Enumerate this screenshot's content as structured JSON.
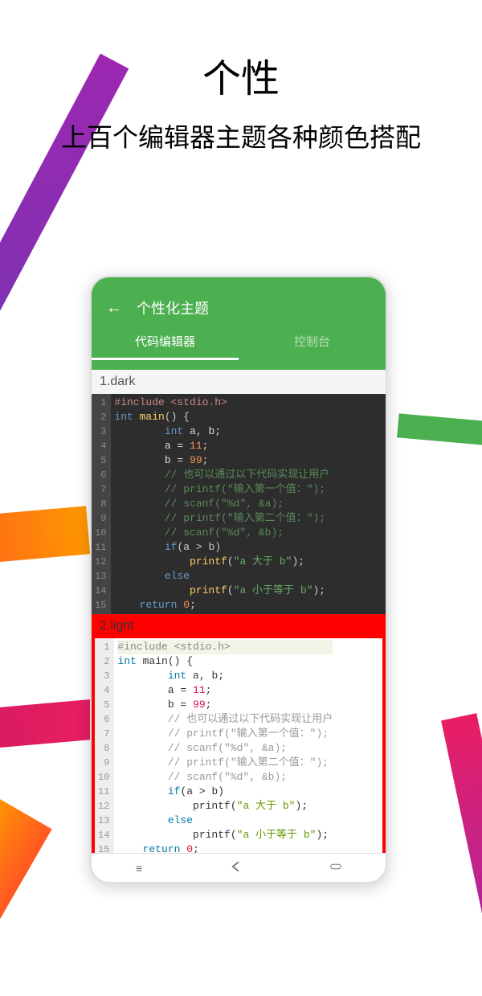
{
  "title": "个性",
  "subtitle": "上百个编辑器主题各种颜色搭配",
  "device": {
    "toolbar_title": "个性化主题",
    "tabs": {
      "editor": "代码编辑器",
      "console": "控制台"
    }
  },
  "themes": {
    "dark_label": "1.dark",
    "light_label": "2.light"
  },
  "code": {
    "line_numbers": [
      "1",
      "2",
      "3",
      "4",
      "5",
      "6",
      "7",
      "8",
      "9",
      "10",
      "11",
      "12",
      "13",
      "14",
      "15"
    ],
    "lines": [
      {
        "tokens": [
          {
            "t": "#include <stdio.h>",
            "c": "pp"
          }
        ]
      },
      {
        "tokens": [
          {
            "t": "int",
            "c": "kw"
          },
          {
            "t": " ",
            "c": "id"
          },
          {
            "t": "main",
            "c": "fn"
          },
          {
            "t": "() {",
            "c": "pn"
          }
        ]
      },
      {
        "tokens": [
          {
            "t": "        ",
            "c": "id"
          },
          {
            "t": "int",
            "c": "kw"
          },
          {
            "t": " a, b;",
            "c": "id"
          }
        ]
      },
      {
        "tokens": [
          {
            "t": "        a = ",
            "c": "id"
          },
          {
            "t": "11",
            "c": "num"
          },
          {
            "t": ";",
            "c": "pn"
          }
        ]
      },
      {
        "tokens": [
          {
            "t": "        b = ",
            "c": "id"
          },
          {
            "t": "99",
            "c": "num"
          },
          {
            "t": ";",
            "c": "pn"
          }
        ]
      },
      {
        "tokens": [
          {
            "t": "        ",
            "c": "id"
          },
          {
            "t": "// 也可以通过以下代码实现让用户",
            "c": "cm"
          }
        ]
      },
      {
        "tokens": [
          {
            "t": "        ",
            "c": "id"
          },
          {
            "t": "// printf(\"输入第一个值：\");",
            "c": "cm"
          }
        ]
      },
      {
        "tokens": [
          {
            "t": "        ",
            "c": "id"
          },
          {
            "t": "// scanf(\"%d\", &a);",
            "c": "cm"
          }
        ]
      },
      {
        "tokens": [
          {
            "t": "        ",
            "c": "id"
          },
          {
            "t": "// printf(\"输入第二个值：\");",
            "c": "cm"
          }
        ]
      },
      {
        "tokens": [
          {
            "t": "        ",
            "c": "id"
          },
          {
            "t": "// scanf(\"%d\", &b);",
            "c": "cm"
          }
        ]
      },
      {
        "tokens": [
          {
            "t": "        ",
            "c": "id"
          },
          {
            "t": "if",
            "c": "kw"
          },
          {
            "t": "(a > b)",
            "c": "pn"
          }
        ]
      },
      {
        "tokens": [
          {
            "t": "            ",
            "c": "id"
          },
          {
            "t": "printf",
            "c": "fn"
          },
          {
            "t": "(",
            "c": "pn"
          },
          {
            "t": "\"a 大于 b\"",
            "c": "str"
          },
          {
            "t": ");",
            "c": "pn"
          }
        ]
      },
      {
        "tokens": [
          {
            "t": "        ",
            "c": "id"
          },
          {
            "t": "else",
            "c": "kw"
          }
        ]
      },
      {
        "tokens": [
          {
            "t": "            ",
            "c": "id"
          },
          {
            "t": "printf",
            "c": "fn"
          },
          {
            "t": "(",
            "c": "pn"
          },
          {
            "t": "\"a 小于等于 b\"",
            "c": "str"
          },
          {
            "t": ");",
            "c": "pn"
          }
        ]
      },
      {
        "tokens": [
          {
            "t": "    ",
            "c": "id"
          },
          {
            "t": "return",
            "c": "kw"
          },
          {
            "t": " ",
            "c": "id"
          },
          {
            "t": "0",
            "c": "num"
          },
          {
            "t": ";",
            "c": "pn"
          }
        ]
      }
    ]
  }
}
